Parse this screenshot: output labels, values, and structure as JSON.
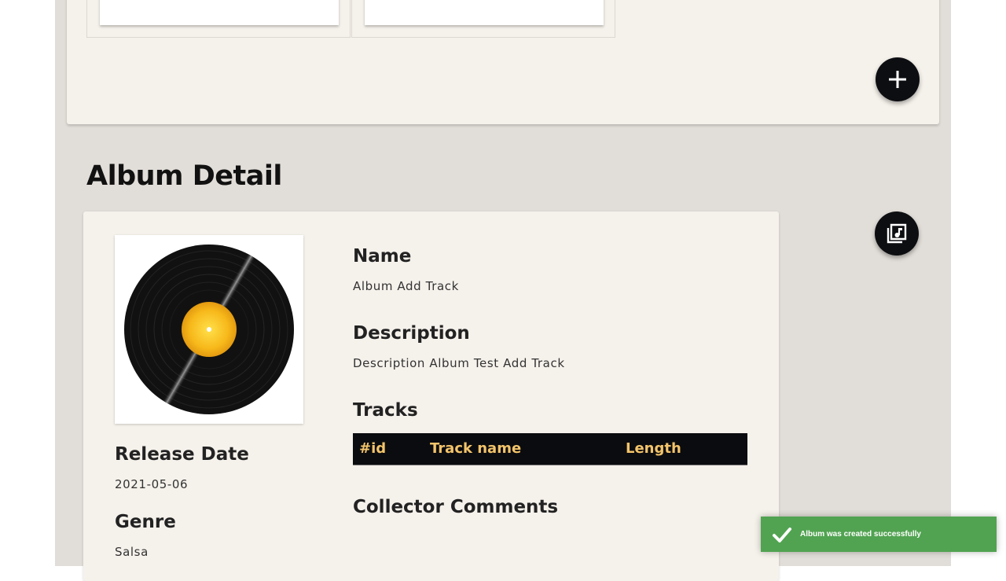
{
  "page": {
    "section_title": "Album Detail"
  },
  "album": {
    "name_label": "Name",
    "name_value": "Album Add Track",
    "description_label": "Description",
    "description_value": "Description Album Test Add Track",
    "tracks_label": "Tracks",
    "release_date_label": "Release Date",
    "release_date_value": "2021-05-06",
    "genre_label": "Genre",
    "genre_value": "Salsa",
    "comments_label": "Collector Comments",
    "cover_icon": "vinyl-record-image"
  },
  "tracks_table": {
    "headers": [
      "#id",
      "Track name",
      "Length"
    ],
    "header_color": "#f3c46b",
    "background": "#0b0c0f"
  },
  "actions": {
    "add_icon": "plus-icon",
    "tracks_icon": "music-library-icon"
  },
  "toast": {
    "message": "Album was created successfully",
    "icon": "checkmark-icon",
    "color": "#51a351"
  },
  "colors": {
    "page_background": "#e1ddd8",
    "card_background": "#f5f1eb",
    "fab": "#0d0e12"
  }
}
